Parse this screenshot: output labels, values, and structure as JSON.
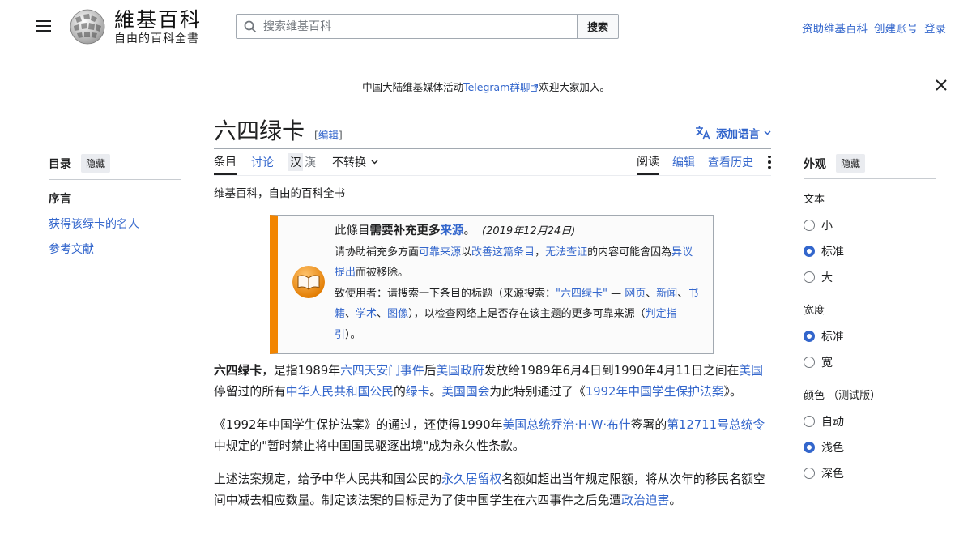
{
  "header": {
    "logo_title": "維基百科",
    "logo_tagline": "自由的百科全書",
    "search_placeholder": "搜索维基百科",
    "search_button": "搜索",
    "user_links": [
      "资助维基百科",
      "创建账号",
      "登录"
    ]
  },
  "banner": {
    "text_before": "中国大陆维基媒体活动",
    "link": "Telegram群聊",
    "text_after": "欢迎大家加入。"
  },
  "toc": {
    "title": "目录",
    "hide": "隐藏",
    "items": [
      "序言",
      "获得该绿卡的名人",
      "参考文献"
    ]
  },
  "article": {
    "title": "六四绿卡",
    "edit_bracket_open": "[",
    "edit_label": "编辑",
    "edit_bracket_close": "]",
    "language_button": "添加语言",
    "tabs": [
      "条目",
      "讨论"
    ],
    "variant_1": "汉",
    "variant_2": "漢",
    "converter": "不转换",
    "right_tabs": [
      "阅读",
      "编辑",
      "查看历史"
    ],
    "tagline": "维基百科，自由的百科全书",
    "ambox": {
      "line1_a": "此條目",
      "line1_b": "需要补充更多",
      "line1_link": "来源",
      "line1_c": "。",
      "date": "(2019年12月24日)",
      "line2_a": "请协助補充多方面",
      "line2_link1": "可靠来源",
      "line2_b": "以",
      "line2_link2": "改善这篇条目",
      "line2_c": "，",
      "line2_link3": "无法查证",
      "line2_d": "的内容可能會因為",
      "line2_link4": "异议提出",
      "line2_e": "而被移除。",
      "line3_a": "致使用者：请搜索一下条目的标题（来源搜索：",
      "line3_link1": "\"六四绿卡\"",
      "line3_b": " — ",
      "line3_link2": "网页",
      "line3_link3": "新闻",
      "line3_link4": "书籍",
      "line3_link5": "学术",
      "line3_link6": "图像",
      "line3_c": "），以检查网络上是否存在该主题的更多可靠来源（",
      "line3_link7": "判定指引",
      "line3_d": "）。"
    },
    "p1": {
      "bold": "六四绿卡",
      "t1": "，是指1989年",
      "l1": "六四天安门事件",
      "t2": "后",
      "l2": "美国政府",
      "t3": "发放给1989年6月4日到1990年4月11日之间在",
      "l3": "美国",
      "t4": "停留过的所有",
      "l4": "中华人民共和国公民",
      "t5": "的",
      "l5": "绿卡",
      "t6": "。",
      "l6": "美国国会",
      "t7": "为此特别通过了《",
      "l7": "1992年中国学生保护法案",
      "t8": "》。"
    },
    "p2": {
      "t1": "《1992年中国学生保护法案》的通过，还使得1990年",
      "l1": "美国总统乔治·H·W·布什",
      "t2": "签署的",
      "l2": "第12711号总统令",
      "t3": "中规定的\"暂时禁止将中国国民驱逐出境\"成为永久性条款。"
    },
    "p3": {
      "t1": "上述法案规定，给予中华人民共和国公民的",
      "l1": "永久居留权",
      "t2": "名额如超出当年规定限额，将从次年的移民名额空间中减去相应数量。制定该法案的目标是为了使中国学生在六四事件之后免遭",
      "l2": "政治迫害",
      "t3": "。"
    }
  },
  "appearance": {
    "title": "外观",
    "hide": "隐藏",
    "text_label": "文本",
    "text_options": [
      "小",
      "标准",
      "大"
    ],
    "text_selected": "标准",
    "width_label": "宽度",
    "width_options": [
      "标准",
      "宽"
    ],
    "width_selected": "标准",
    "color_label": "颜色 （测试版）",
    "color_options": [
      "自动",
      "浅色",
      "深色"
    ],
    "color_selected": "浅色"
  },
  "colors": {
    "link": "#3366cc",
    "accent_orange": "#f28500",
    "text": "#202122"
  },
  "icons": [
    "menu-icon",
    "wikipedia-globe-icon",
    "search-icon",
    "close-icon",
    "translate-icon",
    "chevron-down-icon",
    "more-icon",
    "book-icon",
    "external-link-icon"
  ]
}
